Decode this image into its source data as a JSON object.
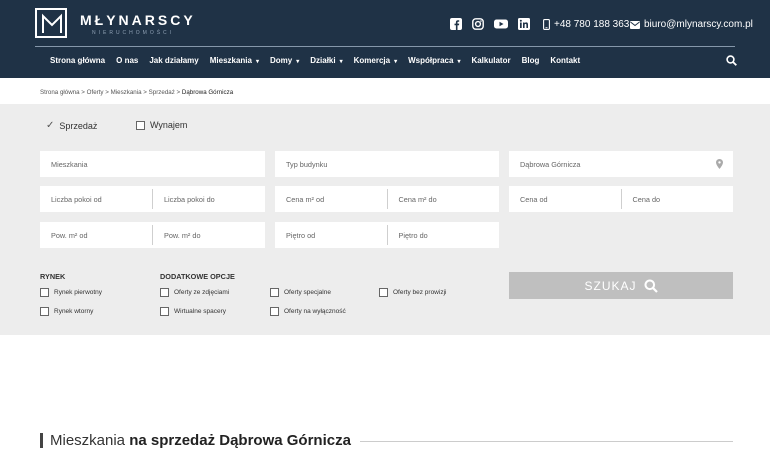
{
  "brand": {
    "name": "MŁYNARSCY",
    "subtitle": "NIERUCHOMOŚCI"
  },
  "header": {
    "social_icons": [
      "facebook-icon",
      "instagram-icon",
      "youtube-icon",
      "linkedin-icon"
    ],
    "phone": "+48 780 188 363",
    "email": "biuro@mlynarscy.com.pl"
  },
  "nav": {
    "items": [
      {
        "label": "Strona główna"
      },
      {
        "label": "O nas"
      },
      {
        "label": "Jak działamy"
      },
      {
        "label": "Mieszkania"
      },
      {
        "label": "Domy"
      },
      {
        "label": "Działki"
      },
      {
        "label": "Komercja"
      },
      {
        "label": "Współpraca"
      },
      {
        "label": "Kalkulator"
      },
      {
        "label": "Blog"
      },
      {
        "label": "Kontakt"
      }
    ]
  },
  "breadcrumb": {
    "items": [
      "Strona główna",
      "Oferty",
      "Mieszkania",
      "Sprzedaż",
      "Dąbrowa Górnicza"
    ],
    "separator": ">"
  },
  "search": {
    "transaction": {
      "sale": "Sprzedaż",
      "rent": "Wynajem"
    },
    "property_type": "Mieszkania",
    "building_type_placeholder": "Typ budynku",
    "location": "Dąbrowa Górnicza",
    "rooms_from": "Liczba pokoi od",
    "rooms_to": "Liczba pokoi do",
    "price_m2_from": "Cena m² od",
    "price_m2_to": "Cena m² do",
    "price_from": "Cena od",
    "price_to": "Cena do",
    "area_from": "Pow. m² od",
    "area_to": "Pow. m² do",
    "floor_from": "Piętro od",
    "floor_to": "Piętro do",
    "market_title": "RYNEK",
    "market_primary": "Rynek pierwotny",
    "market_secondary": "Rynek wtorny",
    "extra_title": "DODATKOWE OPCJE",
    "extra_photos": "Oferty ze zdjęciami",
    "extra_virtual": "Wirtualne spacery",
    "extra_special": "Oferty specjalne",
    "extra_exclusive": "Oferty na wyłączność",
    "extra_no_commission": "Oferty bez prowizji",
    "submit": "SZUKAJ"
  },
  "section": {
    "title_light": "Mieszkania ",
    "title_bold": "na sprzedaż Dąbrowa Górnicza"
  }
}
